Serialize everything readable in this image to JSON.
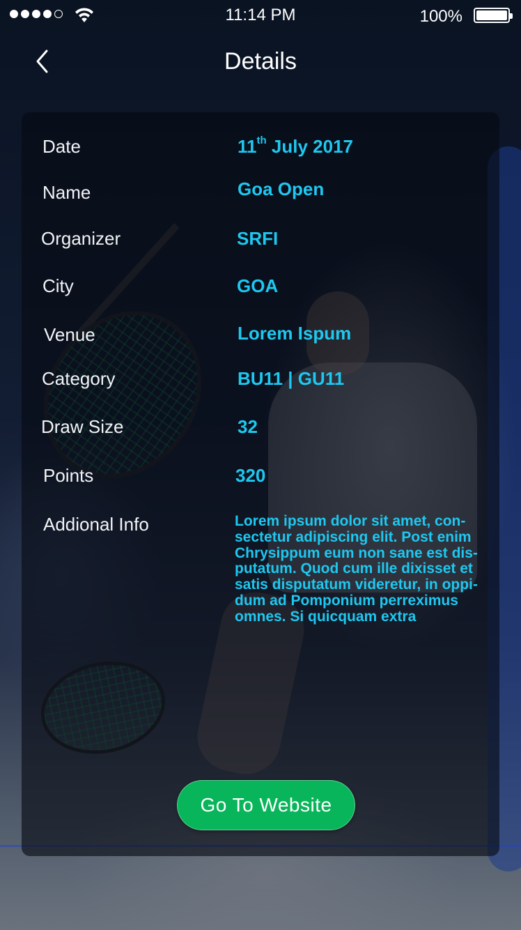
{
  "status_bar": {
    "time": "11:14 PM",
    "battery_percent": "100%",
    "signal_bars_filled": 4,
    "signal_bars_total": 5
  },
  "nav": {
    "title": "Details",
    "back_icon": "chevron-left-icon"
  },
  "details": {
    "date_label": "Date",
    "date_day": "11",
    "date_suffix": "th",
    "date_rest": " July 2017",
    "name_label": "Name",
    "name_value": "Goa Open",
    "organizer_label": "Organizer",
    "organizer_value": "SRFI",
    "city_label": "City",
    "city_value": "GOA",
    "venue_label": "Venue",
    "venue_value": "Lorem Ispum",
    "category_label": "Category",
    "category_value": "BU11 | GU11",
    "draw_size_label": "Draw Size",
    "draw_size_value": "32",
    "points_label": "Points",
    "points_value": "320",
    "info_label": "Addional Info",
    "info_lines": [
      "Lorem ipsum dolor sit amet, con-",
      "sectetur adipiscing elit. Post enim",
      "Chrysippum eum non sane est dis-",
      "putatum. Quod cum ille dixisset et",
      "satis disputatum videretur, in oppi-",
      "dum ad Pomponium perreximus",
      "omnes. Si quicquam extra"
    ]
  },
  "actions": {
    "website_button": "Go To Website",
    "accent_color": "#09b55a",
    "value_color": "#1ec8f0"
  }
}
